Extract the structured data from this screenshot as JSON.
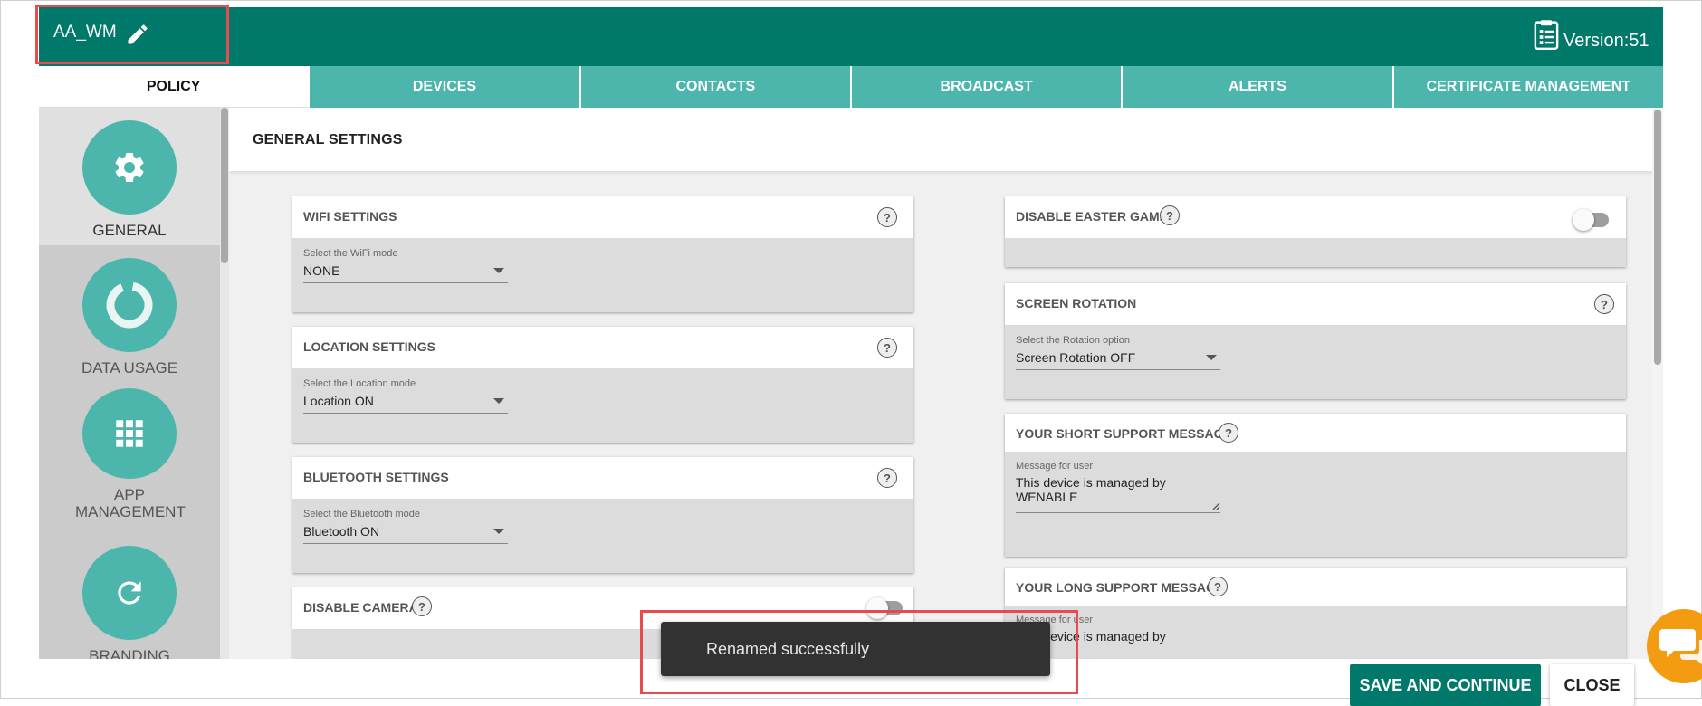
{
  "header": {
    "policy_name": "AA_WM",
    "version": "Version:51"
  },
  "tabs": [
    {
      "label": "POLICY"
    },
    {
      "label": "DEVICES"
    },
    {
      "label": "CONTACTS"
    },
    {
      "label": "BROADCAST"
    },
    {
      "label": "ALERTS"
    },
    {
      "label": "CERTIFICATE MANAGEMENT"
    }
  ],
  "nav": [
    {
      "label": "GENERAL",
      "icon": "gear-icon"
    },
    {
      "label": "DATA USAGE",
      "icon": "donut-icon"
    },
    {
      "label": "APP MANAGEMENT",
      "icon": "grid-icon"
    },
    {
      "label": "BRANDING",
      "icon": "refresh-icon"
    }
  ],
  "section": {
    "title": "GENERAL SETTINGS"
  },
  "cards": {
    "wifi": {
      "title": "WIFI SETTINGS",
      "field_label": "Select the WiFi mode",
      "value": "NONE"
    },
    "location": {
      "title": "LOCATION SETTINGS",
      "field_label": "Select the Location mode",
      "value": "Location ON"
    },
    "bluetooth": {
      "title": "BLUETOOTH SETTINGS",
      "field_label": "Select the Bluetooth mode",
      "value": "Bluetooth ON"
    },
    "camera": {
      "title": "DISABLE CAMERA"
    },
    "easter": {
      "title": "DISABLE EASTER GAME"
    },
    "rotation": {
      "title": "SCREEN ROTATION",
      "field_label": "Select the Rotation option",
      "value": "Screen Rotation OFF"
    },
    "short_msg": {
      "title": "YOUR SHORT SUPPORT MESSAGE",
      "field_label": "Message for user",
      "line1": "This device is managed by",
      "line2": "WENABLE"
    },
    "long_msg": {
      "title": "YOUR LONG SUPPORT MESSAGE",
      "field_label": "Message for user",
      "line1": "This device is managed by"
    }
  },
  "help_glyph": "?",
  "snackbar": {
    "text": "Renamed successfully"
  },
  "buttons": {
    "save": "SAVE AND CONTINUE",
    "close": "CLOSE"
  },
  "colors": {
    "primary": "#00796b",
    "tab": "#4db6ac",
    "highlight": "#e84a4f",
    "chat": "#f39c12"
  }
}
